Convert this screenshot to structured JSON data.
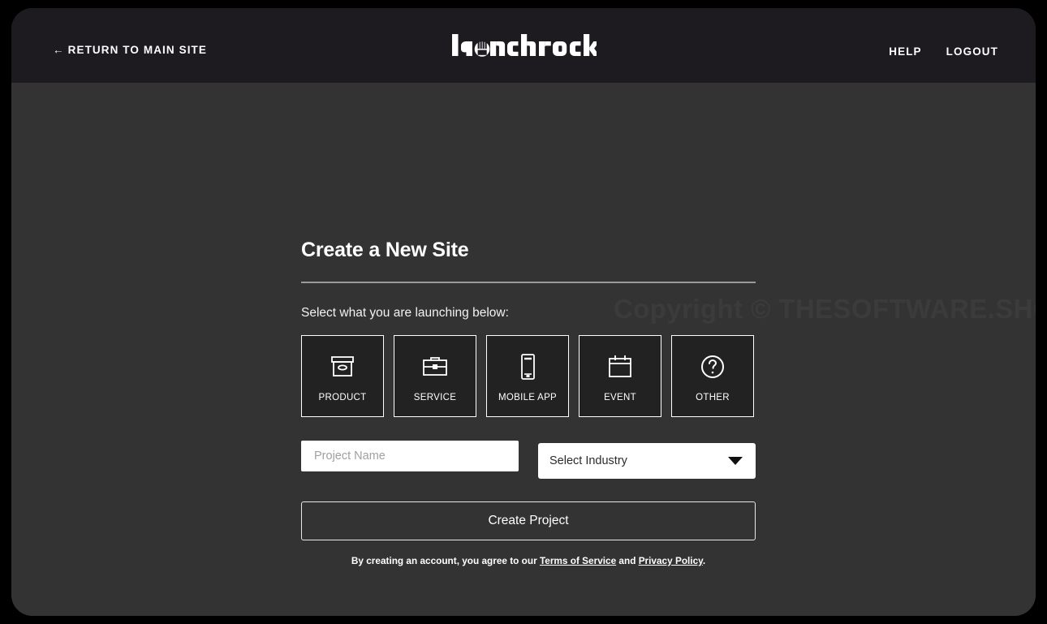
{
  "header": {
    "return_link": "RETURN TO MAIN SITE",
    "return_arrow": "←",
    "logo_text": "launchrock",
    "nav": [
      {
        "label": "HELP"
      },
      {
        "label": "LOGOUT"
      }
    ]
  },
  "watermark": "Copyright © THESOFTWARE.SHOP",
  "main": {
    "title": "Create a New Site",
    "prompt": "Select what you are launching below:",
    "categories": [
      {
        "label": "PRODUCT",
        "icon": "box-icon"
      },
      {
        "label": "SERVICE",
        "icon": "briefcase-icon"
      },
      {
        "label": "MOBILE APP",
        "icon": "mobile-phone-icon"
      },
      {
        "label": "EVENT",
        "icon": "calendar-icon"
      },
      {
        "label": "OTHER",
        "icon": "question-mark-circle-icon"
      }
    ],
    "project_name": {
      "value": "",
      "placeholder": "Project Name"
    },
    "industry": {
      "selected": "Select Industry",
      "caret_icon": "chevron-down-icon"
    },
    "submit_label": "Create Project",
    "terms": {
      "prefix": "By creating an account, you agree to our ",
      "terms_link": "Terms of Service",
      "conjunction": " and ",
      "privacy_link": "Privacy Policy",
      "suffix": "."
    }
  },
  "colors": {
    "page_background": "#000000",
    "header_background": "#1d1a20",
    "body_background": "#333333",
    "card_background": "#222222",
    "accent_white": "#ffffff",
    "input_background": "#ffffff",
    "placeholder_gray": "#a0a0a0"
  }
}
